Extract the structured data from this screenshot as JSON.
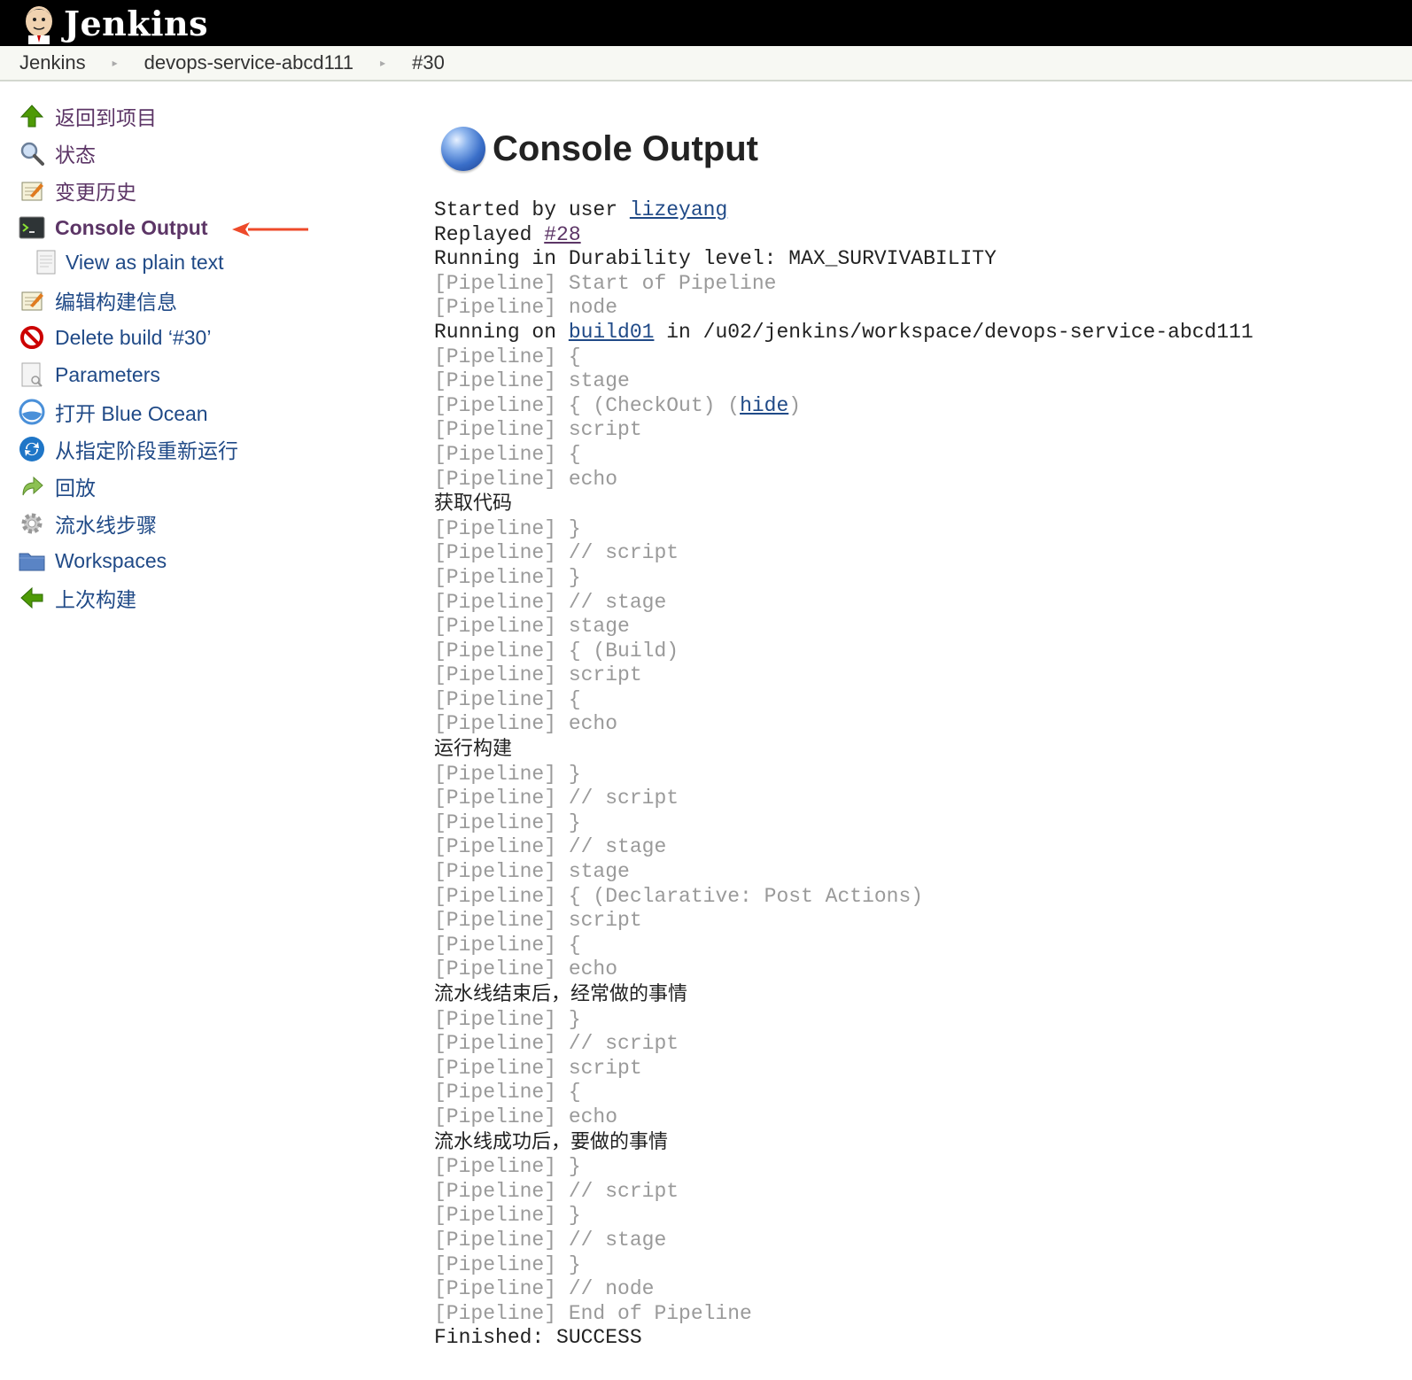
{
  "header": {
    "brand": "Jenkins"
  },
  "breadcrumb": {
    "items": [
      "Jenkins",
      "devops-service-abcd111",
      "#30"
    ]
  },
  "sidebar": {
    "items": [
      {
        "label": "返回到项目",
        "icon": "up-arrow-icon"
      },
      {
        "label": "状态",
        "icon": "search-icon"
      },
      {
        "label": "变更历史",
        "icon": "notepad-icon"
      },
      {
        "label": "Console Output",
        "icon": "terminal-icon"
      },
      {
        "label": "View as plain text",
        "icon": "document-icon"
      },
      {
        "label": "编辑构建信息",
        "icon": "notepad-icon"
      },
      {
        "label": "Delete build ‘#30’",
        "icon": "no-entry-icon"
      },
      {
        "label": "Parameters",
        "icon": "document-icon"
      },
      {
        "label": "打开 Blue Ocean",
        "icon": "blue-ocean-icon"
      },
      {
        "label": "从指定阶段重新运行",
        "icon": "restart-icon"
      },
      {
        "label": "回放",
        "icon": "replay-icon"
      },
      {
        "label": "流水线步骤",
        "icon": "gear-icon"
      },
      {
        "label": "Workspaces",
        "icon": "folder-icon"
      },
      {
        "label": "上次构建",
        "icon": "left-arrow-icon"
      }
    ]
  },
  "main": {
    "title": "Console Output",
    "started_prefix": "Started by user ",
    "started_user": "lizeyang",
    "replayed_prefix": "Replayed ",
    "replayed_link": "#28",
    "durability": "Running in Durability level: MAX_SURVIVABILITY",
    "running_on_prefix": "Running on ",
    "running_on_node": "build01",
    "running_on_suffix": " in /u02/jenkins/workspace/devops-service-abcd111",
    "checkout_text": "{ (CheckOut) (",
    "hide_link": "hide",
    "checkout_close": ")",
    "pipeline_tag": "[Pipeline]",
    "finished": "Finished: SUCCESS"
  },
  "log": [
    {
      "t": "pl",
      "text": "Start of Pipeline"
    },
    {
      "t": "pl",
      "text": "node"
    },
    {
      "t": "runon"
    },
    {
      "t": "pl",
      "text": "{"
    },
    {
      "t": "pl",
      "text": "stage"
    },
    {
      "t": "checkout"
    },
    {
      "t": "pl",
      "text": "script"
    },
    {
      "t": "pl",
      "text": "{"
    },
    {
      "t": "pl",
      "text": "echo"
    },
    {
      "t": "cn",
      "text": "获取代码"
    },
    {
      "t": "pl",
      "text": "}"
    },
    {
      "t": "pl",
      "text": "// script"
    },
    {
      "t": "pl",
      "text": "}"
    },
    {
      "t": "pl",
      "text": "// stage"
    },
    {
      "t": "pl",
      "text": "stage"
    },
    {
      "t": "pl",
      "text": "{ (Build)"
    },
    {
      "t": "pl",
      "text": "script"
    },
    {
      "t": "pl",
      "text": "{"
    },
    {
      "t": "pl",
      "text": "echo"
    },
    {
      "t": "cn",
      "text": "运行构建"
    },
    {
      "t": "pl",
      "text": "}"
    },
    {
      "t": "pl",
      "text": "// script"
    },
    {
      "t": "pl",
      "text": "}"
    },
    {
      "t": "pl",
      "text": "// stage"
    },
    {
      "t": "pl",
      "text": "stage"
    },
    {
      "t": "pl",
      "text": "{ (Declarative: Post Actions)"
    },
    {
      "t": "pl",
      "text": "script"
    },
    {
      "t": "pl",
      "text": "{"
    },
    {
      "t": "pl",
      "text": "echo"
    },
    {
      "t": "cn",
      "text": "流水线结束后，经常做的事情"
    },
    {
      "t": "pl",
      "text": "}"
    },
    {
      "t": "pl",
      "text": "// script"
    },
    {
      "t": "pl",
      "text": "script"
    },
    {
      "t": "pl",
      "text": "{"
    },
    {
      "t": "pl",
      "text": "echo"
    },
    {
      "t": "cn",
      "text": "流水线成功后，要做的事情"
    },
    {
      "t": "pl",
      "text": "}"
    },
    {
      "t": "pl",
      "text": "// script"
    },
    {
      "t": "pl",
      "text": "}"
    },
    {
      "t": "pl",
      "text": "// stage"
    },
    {
      "t": "pl",
      "text": "}"
    },
    {
      "t": "pl",
      "text": "// node"
    },
    {
      "t": "pl",
      "text": "End of Pipeline"
    }
  ]
}
